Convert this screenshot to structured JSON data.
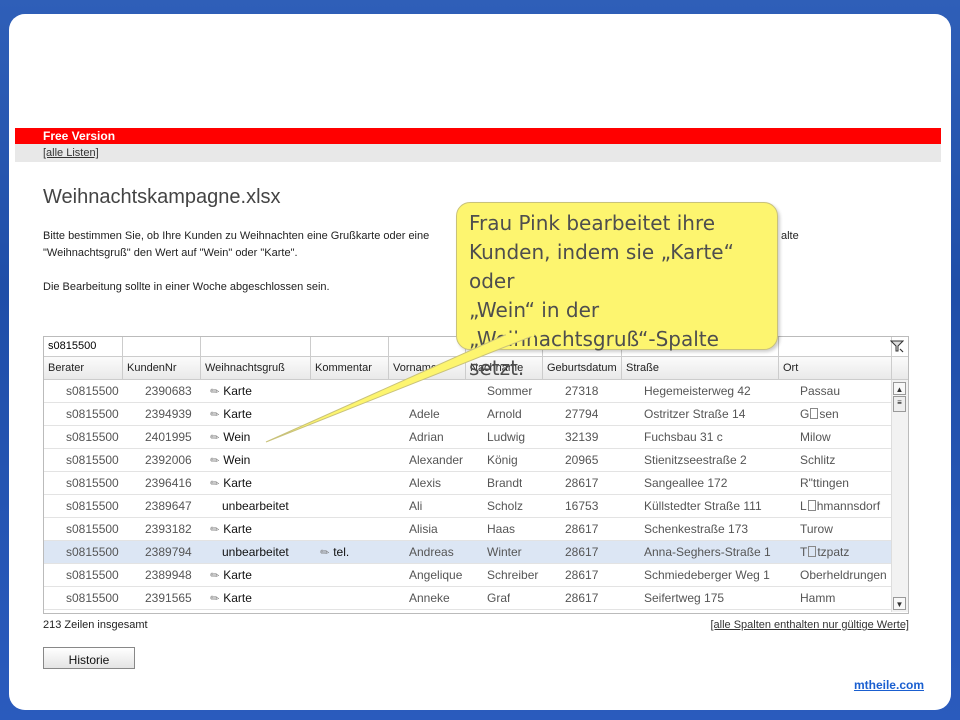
{
  "banner": {
    "version_label": "Free Version",
    "all_lists_link": "[alle Listen]"
  },
  "page": {
    "title": "Weihnachtskampagne.xlsx",
    "intro_line1": "Bitte bestimmen Sie, ob Ihre Kunden zu Weihnachten eine Grußkarte oder eine",
    "intro_line1_end": "alte",
    "intro_line2": "\"Weihnachtsgruß\" den Wert auf \"Wein\" oder \"Karte\".",
    "intro_line3": "Die Bearbeitung sollte in einer Woche abgeschlossen sein."
  },
  "grid": {
    "filter_value": "s0815500",
    "filter_icon": "funnel-icon",
    "columns": [
      "Berater",
      "KundenNr",
      "Weihnachtsgruß",
      "Kommentar",
      "Vorname",
      "Nachname",
      "Geburtsdatum",
      "Straße",
      "Ort"
    ],
    "rows": [
      {
        "berater": "s0815500",
        "kundennr": "2390683",
        "gruss": "Karte",
        "edited": true,
        "kommentar": "",
        "vorname": "",
        "nachname": "Sommer",
        "datum": "27318",
        "strasse": "Hegemeisterweg 42",
        "ort": "Passau"
      },
      {
        "berater": "s0815500",
        "kundennr": "2394939",
        "gruss": "Karte",
        "edited": true,
        "kommentar": "",
        "vorname": "Adele",
        "nachname": "Arnold",
        "datum": "27794",
        "strasse": "Ostritzer Straße 14",
        "ort_a": "G",
        "ort_b": "sen"
      },
      {
        "berater": "s0815500",
        "kundennr": "2401995",
        "gruss": "Wein",
        "edited": true,
        "kommentar": "",
        "vorname": "Adrian",
        "nachname": "Ludwig",
        "datum": "32139",
        "strasse": "Fuchsbau 31 c",
        "ort": "Milow"
      },
      {
        "berater": "s0815500",
        "kundennr": "2392006",
        "gruss": "Wein",
        "edited": true,
        "kommentar": "",
        "vorname": "Alexander",
        "nachname": "König",
        "datum": "20965",
        "strasse": "Stienitzseestraße 2",
        "ort": "Schlitz"
      },
      {
        "berater": "s0815500",
        "kundennr": "2396416",
        "gruss": "Karte",
        "edited": true,
        "kommentar": "",
        "vorname": "Alexis",
        "nachname": "Brandt",
        "datum": "28617",
        "strasse": "Sangeallee 172",
        "ort": "R\"ttingen"
      },
      {
        "berater": "s0815500",
        "kundennr": "2389647",
        "gruss": "unbearbeitet",
        "edited": false,
        "kommentar": "",
        "vorname": "Ali",
        "nachname": "Scholz",
        "datum": "16753",
        "strasse": "Küllstedter Straße 111",
        "ort_a": "L",
        "ort_b": "hmannsdorf"
      },
      {
        "berater": "s0815500",
        "kundennr": "2393182",
        "gruss": "Karte",
        "edited": true,
        "kommentar": "",
        "vorname": "Alisia",
        "nachname": "Haas",
        "datum": "28617",
        "strasse": "Schenkestraße 173",
        "ort": "Turow"
      },
      {
        "berater": "s0815500",
        "kundennr": "2389794",
        "gruss": "unbearbeitet",
        "edited": false,
        "kommentar": "tel.",
        "vorname": "Andreas",
        "nachname": "Winter",
        "datum": "28617",
        "strasse": "Anna-Seghers-Straße 1",
        "ort_a": "T",
        "ort_b": "tzpatz",
        "selected": true
      },
      {
        "berater": "s0815500",
        "kundennr": "2389948",
        "gruss": "Karte",
        "edited": true,
        "kommentar": "",
        "vorname": "Angelique",
        "nachname": "Schreiber",
        "datum": "28617",
        "strasse": "Schmiedeberger Weg 1",
        "ort": "Oberheldrungen"
      },
      {
        "berater": "s0815500",
        "kundennr": "2391565",
        "gruss": "Karte",
        "edited": true,
        "kommentar": "",
        "vorname": "Anneke",
        "nachname": "Graf",
        "datum": "28617",
        "strasse": "Seifertweg 175",
        "ort": "Hamm"
      }
    ]
  },
  "footer": {
    "total_rows": "213 Zeilen insgesamt",
    "valid_link": "[alle Spalten enthalten nur gültige Werte]",
    "history_button": "Historie"
  },
  "callout": {
    "text_line1": "Frau Pink bearbeitet ihre",
    "text_line2": "Kunden, indem sie „Karte“ oder",
    "text_line3": "„Wein“ in der",
    "text_line4": "„Weihnachtsgruß“-Spalte setzt."
  },
  "brand": "mtheile.com",
  "colors": {
    "banner_red": "#ff0000",
    "callout_yellow": "#fdf56f",
    "selected_row": "#dce6f4",
    "frame_blue": "#2a5bbd"
  }
}
